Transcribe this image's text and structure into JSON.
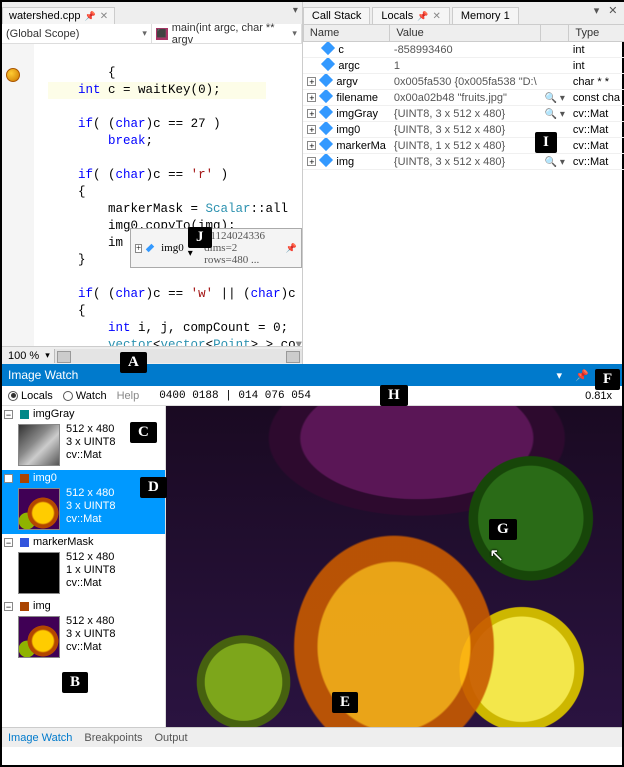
{
  "code_tab": {
    "label": "watershed.cpp",
    "pin": "📌",
    "close": "✕"
  },
  "scope": {
    "left": "(Global Scope)",
    "right": "main(int argc, char ** argv"
  },
  "code_lines": [
    "{",
    "int c = waitKey(0);",
    "",
    "if( (char)c == 27 )",
    "    break;",
    "",
    "if( (char)c == 'r' )",
    "{",
    "    markerMask = Scalar::all",
    "    img0.copyTo(img);",
    "    im",
    "}",
    "",
    "if( (char)c == 'w' || (char)c",
    "{",
    "    int i, j, compCount = 0;",
    "    vector<vector<Point> > co"
  ],
  "datatip": {
    "name": "img0",
    "value": "=1124024336 dims=2 rows=480 ..."
  },
  "zoom": "100 %",
  "locals_tabs": {
    "callstack": "Call Stack",
    "locals": "Locals",
    "memory": "Memory 1"
  },
  "locals_cols": {
    "name": "Name",
    "value": "Value",
    "type": "Type"
  },
  "locals_rows": [
    {
      "exp": "",
      "name": "c",
      "value": "-858993460",
      "vis": "",
      "type": "int"
    },
    {
      "exp": "",
      "name": "argc",
      "value": "1",
      "vis": "",
      "type": "int"
    },
    {
      "exp": "+",
      "name": "argv",
      "value": "0x005fa530 {0x005fa538 \"D:\\",
      "vis": "",
      "type": "char * *"
    },
    {
      "exp": "+",
      "name": "filename",
      "value": "0x00a02b48 \"fruits.jpg\"",
      "vis": "🔍 ▾",
      "type": "const cha"
    },
    {
      "exp": "+",
      "name": "imgGray",
      "value": "{UINT8, 3 x 512 x 480}",
      "vis": "🔍 ▾",
      "type": "cv::Mat"
    },
    {
      "exp": "+",
      "name": "img0",
      "value": "{UINT8, 3 x 512 x 480}",
      "vis": " ",
      "type": "cv::Mat"
    },
    {
      "exp": "+",
      "name": "markerMa",
      "value": "{UINT8, 1 x 512 x 480}",
      "vis": " ",
      "type": "cv::Mat"
    },
    {
      "exp": "+",
      "name": "img",
      "value": "{UINT8, 3 x 512 x 480}",
      "vis": "🔍 ▾",
      "type": "cv::Mat"
    }
  ],
  "iw": {
    "title": "Image Watch",
    "radio_locals": "Locals",
    "radio_watch": "Watch",
    "help": "Help",
    "readout": "0400 0188 | 014 076 054",
    "zoom": "0.81x"
  },
  "iw_items": [
    {
      "name": "imgGray",
      "dims": "512 x 480",
      "chan": "3 x UINT8",
      "type": "cv::Mat",
      "thumb": "th-gray",
      "color": "#008888"
    },
    {
      "name": "img0",
      "dims": "512 x 480",
      "chan": "3 x UINT8",
      "type": "cv::Mat",
      "thumb": "th-color",
      "color": "#aa4400",
      "selected": true
    },
    {
      "name": "markerMask",
      "dims": "512 x 480",
      "chan": "1 x UINT8",
      "type": "cv::Mat",
      "thumb": "th-black",
      "color": "#3355dd"
    },
    {
      "name": "img",
      "dims": "512 x 480",
      "chan": "3 x UINT8",
      "type": "cv::Mat",
      "thumb": "th-color",
      "color": "#aa4400"
    }
  ],
  "bottom_tabs": {
    "iw": "Image Watch",
    "bp": "Breakpoints",
    "out": "Output"
  },
  "labels": {
    "A": "A",
    "B": "B",
    "C": "C",
    "D": "D",
    "E": "E",
    "F": "F",
    "G": "G",
    "H": "H",
    "I": "I",
    "J": "J"
  }
}
